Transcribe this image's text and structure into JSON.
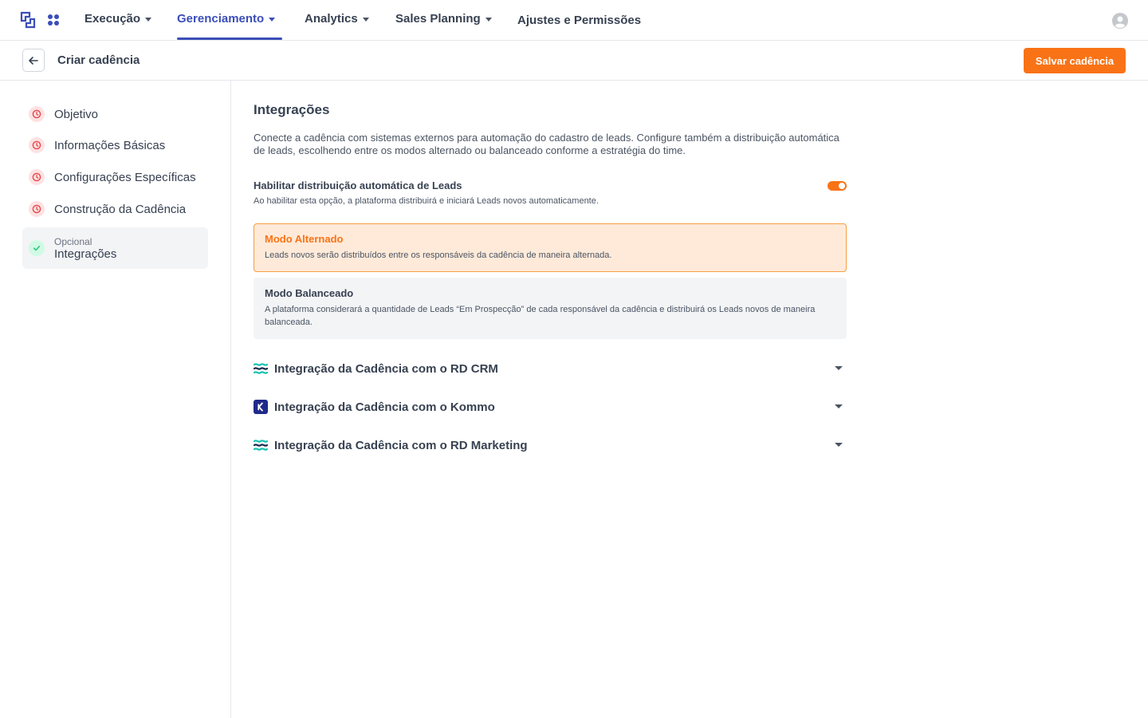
{
  "nav": {
    "items": [
      {
        "label": "Execução",
        "has_caret": true
      },
      {
        "label": "Gerenciamento",
        "has_caret": true,
        "active": true
      },
      {
        "label": "Analytics",
        "has_caret": true
      },
      {
        "label": "Sales Planning",
        "has_caret": true
      },
      {
        "label": "Ajustes e Permissões",
        "has_caret": false
      }
    ],
    "active_color": "#3b4eb8"
  },
  "header": {
    "title": "Criar cadência",
    "save_label": "Salvar cadência",
    "accent": "#f97316"
  },
  "sidebar": {
    "steps": [
      {
        "label": "Objetivo",
        "status": "pending"
      },
      {
        "label": "Informações Básicas",
        "status": "pending"
      },
      {
        "label": "Configurações Específicas",
        "status": "pending"
      },
      {
        "label": "Construção da Cadência",
        "status": "pending"
      },
      {
        "sub": "Opcional",
        "label": "Integrações",
        "status": "done",
        "active": true
      }
    ]
  },
  "main": {
    "title": "Integrações",
    "description": "Conecte a cadência com sistemas externos para automação do cadastro de leads. Configure também a distribuição automática de leads, escolhendo entre os modos alternado ou balanceado conforme a estratégia do time.",
    "toggle": {
      "title": "Habilitar distribuição automática de Leads",
      "description": "Ao habilitar esta opção, a plataforma distribuirá e iniciará Leads novos automaticamente.",
      "enabled": true
    },
    "modes": [
      {
        "title": "Modo Alternado",
        "description": "Leads novos serão distribuídos entre os responsáveis da cadência de maneira alternada.",
        "selected": true
      },
      {
        "title": "Modo Balanceado",
        "description": "A plataforma considerará a quantidade de Leads “Em Prospecção” de cada responsável da cadência e distribuirá os Leads novos de maneira balanceada.",
        "selected": false
      }
    ],
    "integrations": [
      {
        "label": "Integração da Cadência com o RD CRM",
        "icon": "rd-station-icon"
      },
      {
        "label": "Integração da Cadência com o Kommo",
        "icon": "kommo-icon"
      },
      {
        "label": "Integração da Cadência com o RD Marketing",
        "icon": "rd-station-icon"
      }
    ]
  }
}
